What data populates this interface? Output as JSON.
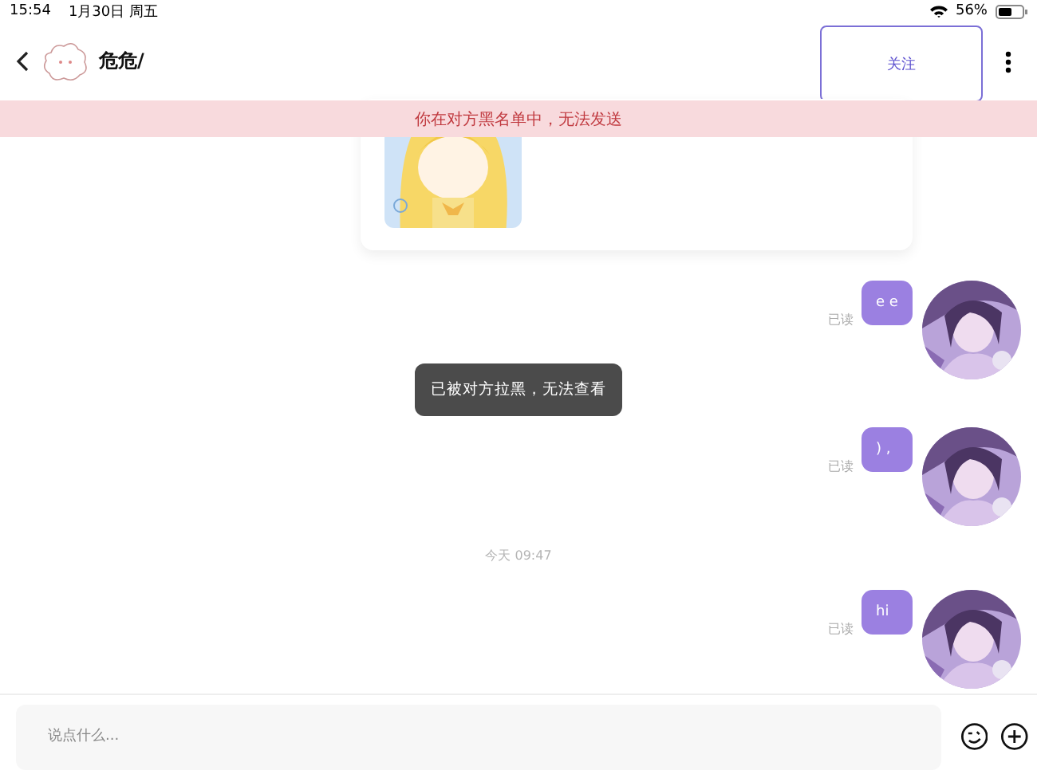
{
  "status_bar": {
    "time": "15:54",
    "date": "1月30日 周五",
    "battery": "56%"
  },
  "header": {
    "title": "危危/",
    "follow_button": "关注"
  },
  "banner": "你在对方黑名单中，无法发送",
  "messages": [
    {
      "kind": "outgoing",
      "text": "e e",
      "receipt": "已读"
    },
    {
      "kind": "outgoing",
      "text": ") ,",
      "receipt": "已读"
    },
    {
      "kind": "time",
      "text": "今天 09:47"
    },
    {
      "kind": "outgoing",
      "text": "hi",
      "receipt": "已读"
    }
  ],
  "toast": "已被对方拉黑，无法查看",
  "composer": {
    "placeholder": "说点什么..."
  }
}
